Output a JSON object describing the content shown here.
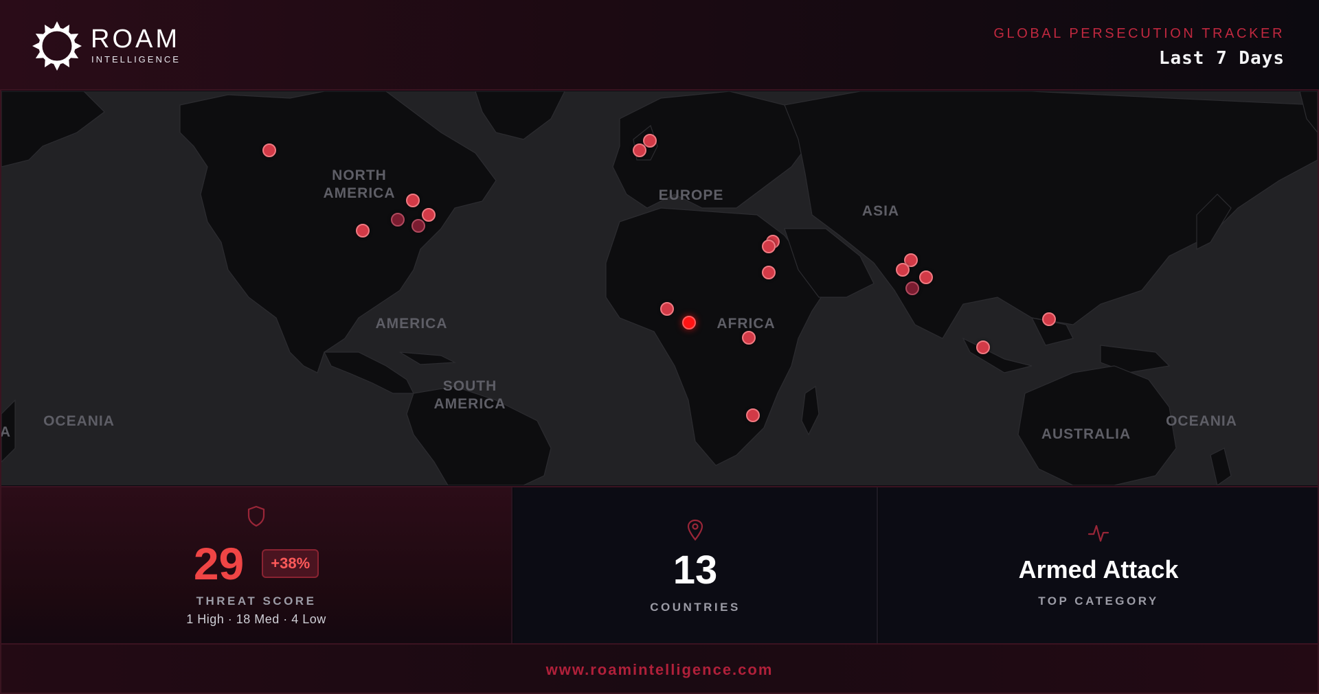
{
  "header": {
    "brand_name": "ROAM",
    "brand_sub": "INTELLIGENCE",
    "tracker_title": "GLOBAL PERSECUTION TRACKER",
    "period": "Last 7 Days"
  },
  "map": {
    "region_labels": {
      "north_america": "NORTH\nAMERICA",
      "europe": "EUROPE",
      "asia": "ASIA",
      "america": "AMERICA",
      "africa": "AFRICA",
      "south_america": "SOUTH\nAMERICA",
      "oceania_left": "OCEANIA",
      "oceania_right": "OCEANIA",
      "australia": "AUSTRALIA",
      "edge_a": "A"
    },
    "incident_colors": {
      "medium": "#d23a47",
      "low": "#7a1c30",
      "high": "#ff1414"
    }
  },
  "stats": {
    "threat": {
      "value": "29",
      "delta": "+38%",
      "label": "THREAT SCORE",
      "breakdown": "1 High · 18 Med · 4 Low",
      "icon": "shield-icon"
    },
    "countries": {
      "value": "13",
      "label": "COUNTRIES",
      "icon": "map-pin-icon"
    },
    "category": {
      "value": "Armed Attack",
      "label": "TOP CATEGORY",
      "icon": "pulse-icon"
    }
  },
  "footer": {
    "url": "www.roamintelligence.com"
  },
  "colors": {
    "accent": "#c0283f",
    "threat": "#ef4545",
    "background": "#0c0c14"
  }
}
